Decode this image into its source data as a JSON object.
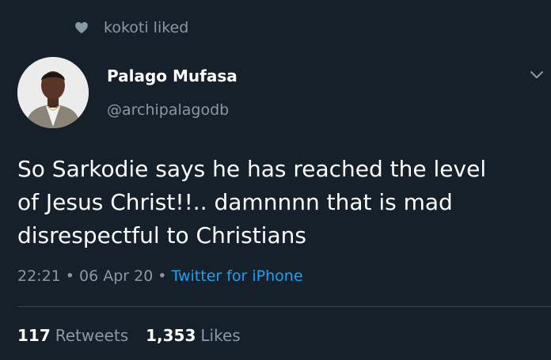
{
  "social_context": {
    "icon": "heart-icon",
    "text": "kokoti liked"
  },
  "author": {
    "avatar": "avatar-photo",
    "display_name": "Palago Mufasa",
    "handle": "@archipalagodb"
  },
  "menu": {
    "icon": "chevron-down-icon"
  },
  "tweet": {
    "line1": "So Sarkodie says he has reached the level",
    "line2": "of Jesus Christ!!.. damnnnn that is mad",
    "line3": "disrespectful to Christians"
  },
  "meta": {
    "time": "22:21",
    "separator": "•",
    "date": "06 Apr 20",
    "source": "Twitter for iPhone"
  },
  "stats": {
    "retweets_count": "117",
    "retweets_label": "Retweets",
    "likes_count": "1,353",
    "likes_label": "Likes"
  },
  "colors": {
    "background": "#15202b",
    "secondary_text": "#8899a6",
    "link": "#1da1f2",
    "divider": "#38444d"
  }
}
